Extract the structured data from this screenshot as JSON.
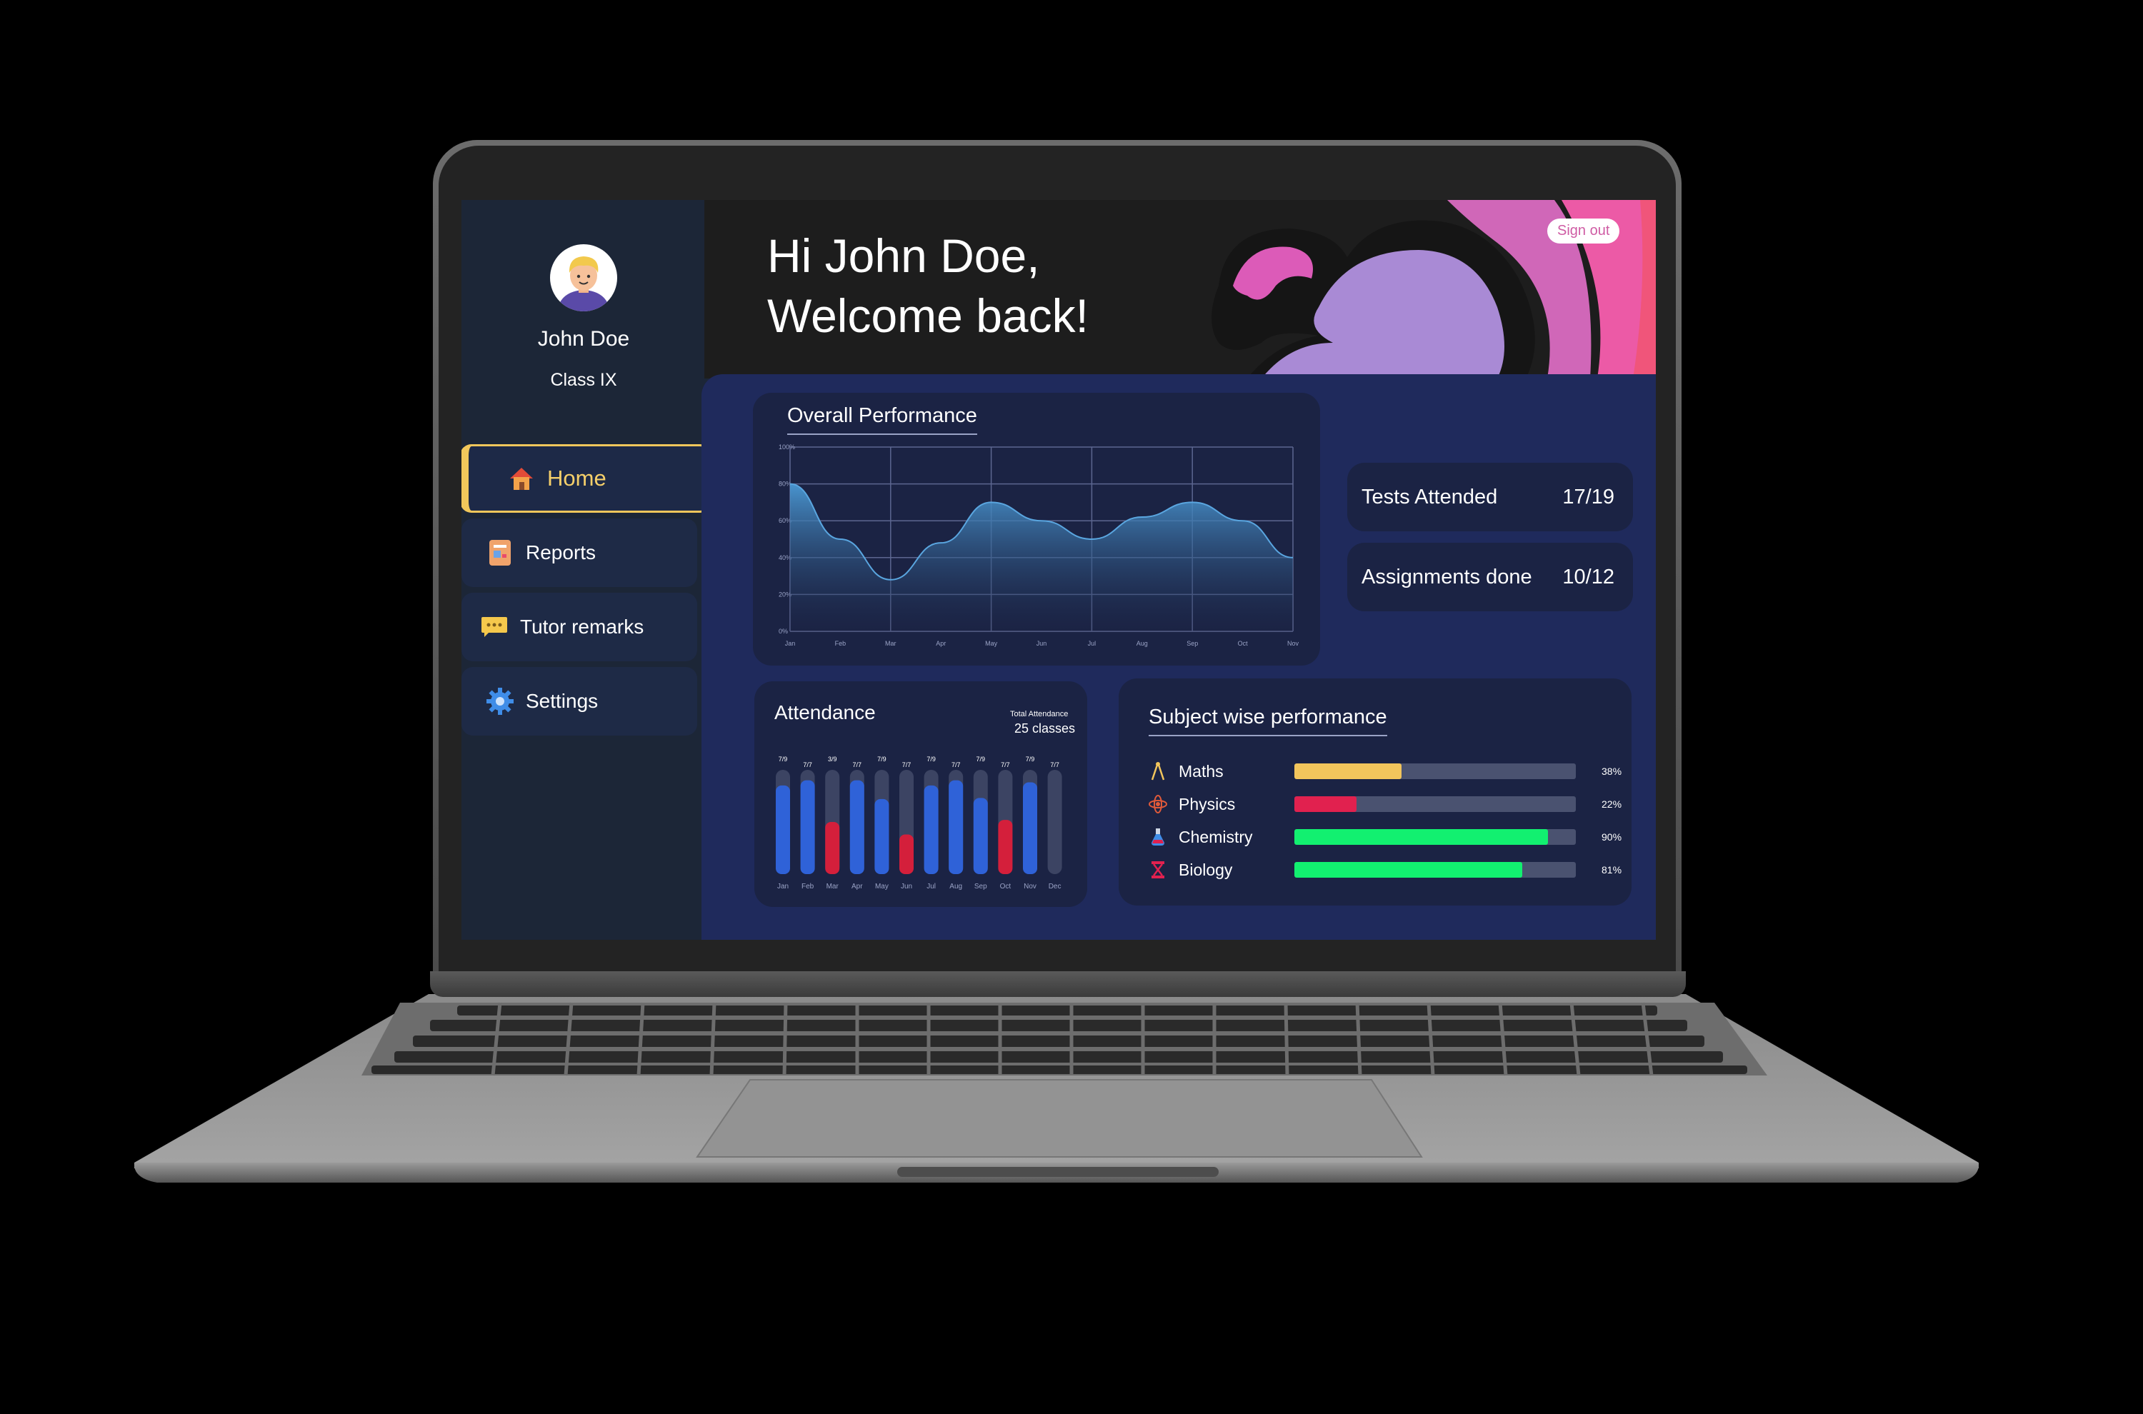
{
  "colors": {
    "accent_yellow": "#f1c75b",
    "attended_blue": "#2f62d8",
    "absent_red": "#d41f3b",
    "track_gray": "#3c4463",
    "maths": "#f2c55c",
    "physics": "#e1214f",
    "chemistry": "#12f070",
    "biology": "#12f070",
    "panel": "#1b2344",
    "content_bg": "#1f2a5c"
  },
  "user": {
    "name": "John Doe",
    "class": "Class IX",
    "avatar_icon": "user-avatar-icon"
  },
  "nav": [
    {
      "label": "Home",
      "icon": "home-icon",
      "active": true
    },
    {
      "label": "Reports",
      "icon": "report-icon",
      "active": false
    },
    {
      "label": "Tutor remarks",
      "icon": "chat-icon",
      "active": false
    },
    {
      "label": "Settings",
      "icon": "gear-icon",
      "active": false
    }
  ],
  "header": {
    "greeting_line1": "Hi John Doe,",
    "greeting_line2": "Welcome back!",
    "signout": "Sign out"
  },
  "stats": [
    {
      "label": "Tests Attended",
      "value": "17/19"
    },
    {
      "label": "Assignments done",
      "value": "10/12"
    }
  ],
  "overall": {
    "title": "Overall Performance",
    "chart_data": {
      "type": "area",
      "title": "Overall Performance",
      "x": [
        "Jan",
        "Feb",
        "Mar",
        "Apr",
        "May",
        "Jun",
        "Jul",
        "Aug",
        "Sep",
        "Oct",
        "Nov"
      ],
      "y_ticks": [
        "100%",
        "80%",
        "60%",
        "40%",
        "20%",
        "0%"
      ],
      "values": [
        80,
        50,
        28,
        48,
        70,
        60,
        50,
        62,
        70,
        60,
        40
      ],
      "ylim": [
        0,
        100
      ],
      "grid": true
    }
  },
  "attendance": {
    "title": "Attendance",
    "total_label": "Total Attendance",
    "total_value": "25 classes",
    "chart_data": {
      "type": "bar",
      "categories": [
        "Jan",
        "Feb",
        "Mar",
        "Apr",
        "May",
        "Jun",
        "Jul",
        "Aug",
        "Sep",
        "Oct",
        "Nov",
        "Dec"
      ],
      "labels": [
        "7/9",
        "7/7",
        "3/9",
        "7/7",
        "7/9",
        "7/7",
        "7/9",
        "7/7",
        "7/9",
        "7/7",
        "7/9",
        "7/7"
      ],
      "values": [
        0.85,
        0.9,
        0.5,
        0.9,
        0.72,
        0.38,
        0.85,
        0.9,
        0.73,
        0.52,
        0.88,
        0
      ],
      "status": [
        "present",
        "present",
        "absent",
        "present",
        "present",
        "absent",
        "present",
        "present",
        "present",
        "absent",
        "present",
        "none"
      ]
    }
  },
  "subjects": {
    "title": "Subject wise performance",
    "chart_data": {
      "type": "bar",
      "categories": [
        "Maths",
        "Physics",
        "Chemistry",
        "Biology"
      ],
      "values": [
        38,
        22,
        90,
        81
      ],
      "labels": [
        "38%",
        "22%",
        "90%",
        "81%"
      ]
    },
    "items": [
      {
        "name": "Maths",
        "pct": "38%",
        "value": 38,
        "color": "#f2c55c",
        "icon": "compass-icon"
      },
      {
        "name": "Physics",
        "pct": "22%",
        "value": 22,
        "color": "#e1214f",
        "icon": "atom-icon"
      },
      {
        "name": "Chemistry",
        "pct": "90%",
        "value": 90,
        "color": "#12f070",
        "icon": "flask-icon"
      },
      {
        "name": "Biology",
        "pct": "81%",
        "value": 81,
        "color": "#12f070",
        "icon": "dna-icon"
      }
    ]
  }
}
